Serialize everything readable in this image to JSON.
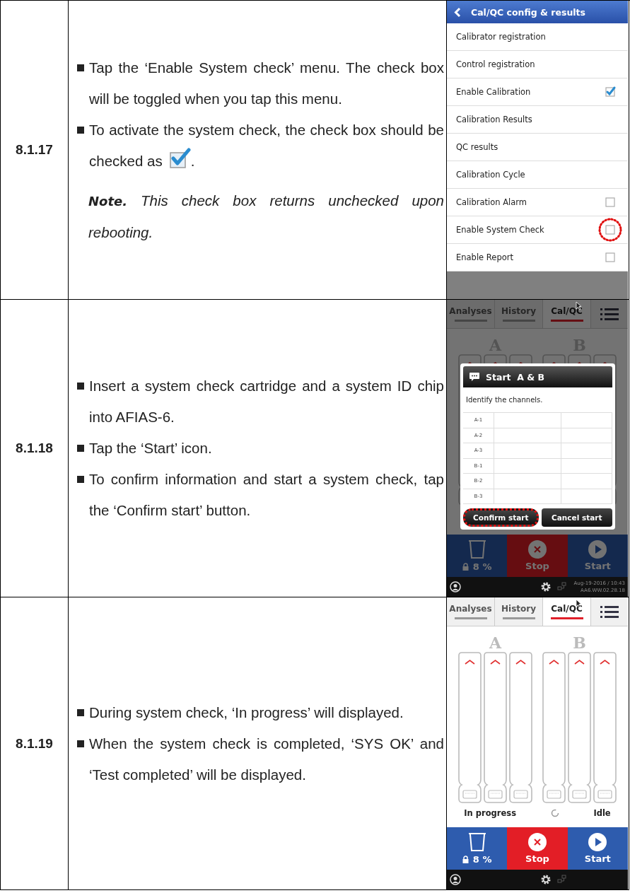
{
  "steps": [
    {
      "number": "8.1.17",
      "bullets": [
        {
          "parts": [
            {
              "kind": "text",
              "text": "Tap the ‘Enable System check’ menu. The check box will be toggled when you tap this menu."
            }
          ]
        },
        {
          "parts": [
            {
              "kind": "text",
              "text": "To activate the system check, the check box should be checked as"
            },
            {
              "kind": "checkbox",
              "checked": true
            },
            {
              "kind": "text",
              "text": "."
            }
          ]
        }
      ],
      "note": "**Note.** This check box returns unchecked upon rebooting.",
      "screen": {
        "kind": "settings",
        "title": "Cal/QC config & results",
        "items": [
          {
            "label": "Calibrator registration",
            "kind": "plain"
          },
          {
            "label": "Control registration",
            "kind": "plain"
          },
          {
            "label": "Enable Calibration",
            "kind": "checkbox",
            "checked": true,
            "highlighted": false
          },
          {
            "label": "Calibration Results",
            "kind": "plain"
          },
          {
            "label": "QC results",
            "kind": "plain"
          },
          {
            "label": "Calibration Cycle",
            "kind": "plain"
          },
          {
            "label": "Calibration Alarm",
            "kind": "checkbox",
            "checked": false,
            "highlighted": false
          },
          {
            "label": "Enable System Check",
            "kind": "checkbox",
            "checked": false,
            "highlighted": true
          },
          {
            "label": "Enable Report",
            "kind": "checkbox",
            "checked": false,
            "highlighted": false
          }
        ]
      }
    },
    {
      "number": "8.1.18",
      "bullets": [
        {
          "parts": [
            {
              "kind": "text",
              "text": "Insert a system check cartridge and a system ID chip into AFIAS-6."
            }
          ]
        },
        {
          "parts": [
            {
              "kind": "text",
              "text": "Tap the ‘Start’ icon."
            }
          ]
        },
        {
          "parts": [
            {
              "kind": "text",
              "text": "To confirm information and start a system check, tap the ‘Confirm start’ button."
            }
          ]
        }
      ],
      "screen": {
        "kind": "main",
        "dimmed": true,
        "tabs": [
          {
            "label": "Analyses",
            "selected": false
          },
          {
            "label": "History",
            "selected": false
          },
          {
            "label": "Cal/QC",
            "selected": true
          }
        ],
        "groups": [
          {
            "label": "A"
          },
          {
            "label": "B"
          }
        ],
        "dialog": {
          "title": "Start  A & B",
          "message": "Identify the channels.",
          "channels": [
            "A-1",
            "A-2",
            "A-3",
            "B-1",
            "B-2",
            "B-3"
          ],
          "buttons": [
            {
              "label": "Confirm start",
              "highlighted": true
            },
            {
              "label": "Cancel start",
              "highlighted": false
            }
          ]
        },
        "waste": "8 %",
        "stop": "Stop",
        "start": "Start",
        "date": "Aug-19-2016 / 10:43",
        "version": "AA6.WW.02.28.18"
      }
    },
    {
      "number": "8.1.19",
      "bullets": [
        {
          "parts": [
            {
              "kind": "text",
              "text": "During system check, ‘In progress’ will displayed."
            }
          ]
        },
        {
          "parts": [
            {
              "kind": "text",
              "text": "When the system check is completed, ‘SYS OK’ and ‘Test completed’ will be displayed."
            }
          ]
        }
      ],
      "screen": {
        "kind": "main",
        "tabs": [
          {
            "label": "Analyses",
            "selected": false
          },
          {
            "label": "History",
            "selected": false
          },
          {
            "label": "Cal/QC",
            "selected": true
          }
        ],
        "groups": [
          {
            "label": "A",
            "status": "In progress",
            "busy": true
          },
          {
            "label": "B",
            "status": "Idle"
          }
        ],
        "waste": "8 %",
        "stop": "Stop",
        "start": "Start"
      }
    }
  ]
}
